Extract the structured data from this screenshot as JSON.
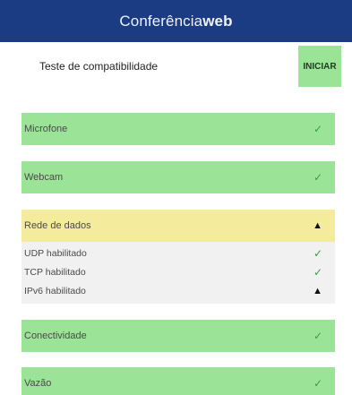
{
  "header": {
    "brand_light": "Conferência",
    "brand_bold": "web"
  },
  "topbar": {
    "title": "Teste de compatibilidade",
    "start_label": "INICIAR"
  },
  "items": {
    "microfone": {
      "label": "Microfone",
      "status_icon": "✓"
    },
    "webcam": {
      "label": "Webcam",
      "status_icon": "✓"
    },
    "rede": {
      "label": "Rede de dados",
      "status_icon": "▲",
      "sub": [
        {
          "label": "UDP habilitado",
          "status_icon": "✓"
        },
        {
          "label": "TCP habilitado",
          "status_icon": "✓"
        },
        {
          "label": "IPv6 habilitado",
          "status_icon": "▲"
        }
      ]
    },
    "conectividade": {
      "label": "Conectividade",
      "status_icon": "✓"
    },
    "vazao": {
      "label": "Vazão",
      "status_icon": "✓"
    }
  },
  "colors": {
    "header_bg": "#1b3b82",
    "success_bg": "#9be497",
    "warning_bg": "#f4ec9c",
    "detail_bg": "#f1f1f1",
    "check_color": "#3f9a3f"
  }
}
